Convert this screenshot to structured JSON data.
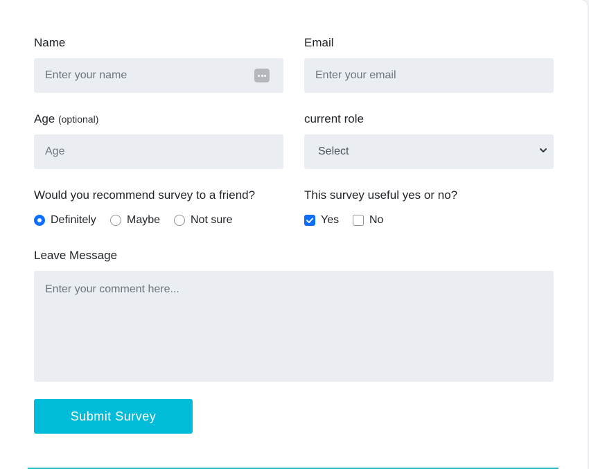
{
  "form": {
    "name": {
      "label": "Name",
      "placeholder": "Enter your name"
    },
    "email": {
      "label": "Email",
      "placeholder": "Enter your email"
    },
    "age": {
      "label": "Age",
      "hint": "(optional)",
      "placeholder": "Age"
    },
    "role": {
      "label": "current role",
      "selected": "Select"
    },
    "recommend": {
      "question": "Would you recommend survey to a friend?",
      "options": [
        "Definitely",
        "Maybe",
        "Not sure"
      ],
      "selected": "Definitely"
    },
    "useful": {
      "question": "This survey useful yes or no?",
      "options": [
        "Yes",
        "No"
      ],
      "checked": [
        "Yes"
      ]
    },
    "message": {
      "label": "Leave Message",
      "placeholder": "Enter your comment here..."
    },
    "submit_label": "Submit Survey"
  },
  "icons": {
    "name_field_icon": "password-manager-icon",
    "select_chevron": "chevron-down-icon"
  },
  "colors": {
    "accent": "#00bcd8",
    "checked": "#0d6efd",
    "field_bg": "#eaedf1"
  }
}
